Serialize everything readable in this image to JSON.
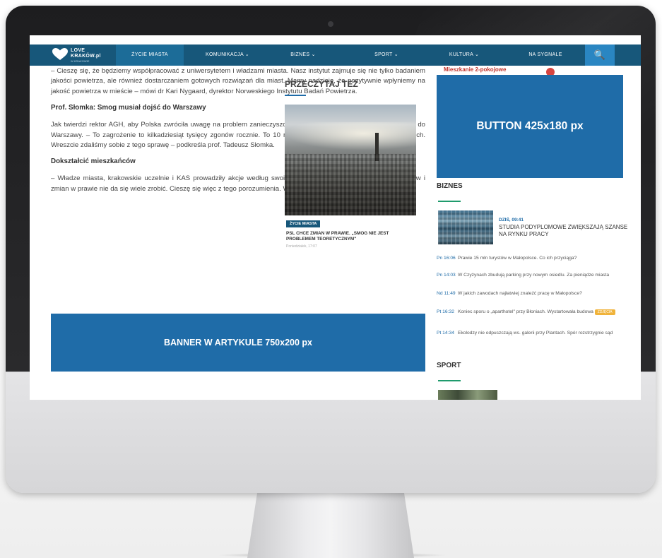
{
  "nav": {
    "logo": {
      "line1": "LOVE",
      "line2": "KRAKÓW.pl",
      "line3": "W KRAKOWIE"
    },
    "items": [
      {
        "label": "ŻYCIE MIASTA",
        "active": true
      },
      {
        "label": "KOMUNIKACJA ⌄"
      },
      {
        "label": "BIZNES ⌄"
      },
      {
        "label": "SPORT ⌄"
      },
      {
        "label": "KULTURA ⌄"
      },
      {
        "label": "NA SYGNALE"
      }
    ],
    "search_icon": "🔍"
  },
  "article": {
    "p1": "– Cieszę się, że będziemy współpracować z uniwersytetem i władzami miasta. Nasz instytut zajmuje się nie tylko badaniem jakości powietrza, ale również dostarczaniem gotowych rozwiązań dla miast. Mamy nadzieję, że pozytywnie wpłyniemy na jakość powietrza w mieście – mówi dr Kari Nygaard, dyrektor Norweskiego Instytutu Badań Powietrza.",
    "h1": "Prof. Słomka: Smog musiał dojść do Warszawy",
    "p2": "Jak twierdzi rektor AGH, aby Polska zwróciła uwagę na problem zanieczyszczonego powietrza, musiało ono dotrzeć aż do Warszawy. – To zagrożenie to kilkadziesiąt tysięcy zgonów rocznie. To 10 razy więcej niż z wypadków samochodowych. Wreszcie zdaliśmy sobie z tego sprawę – podkreśla prof. Tadeusz Słomka.",
    "h2": "Dokształcić mieszkańców",
    "p3": "– Władze miasta, krakowskie uczelnie i KAS prowadziły akcje według swoich możliwości. Jednak bez dużych środków i zmian w prawie nie da się wiele zrobić. Cieszę się więc z tego porozumienia. W AGH"
  },
  "banner": {
    "label": "BANNER W ARTYKULE 750x200 px"
  },
  "read_more": {
    "header": "PRZECZYTAJ TEŻ",
    "tag": "ŻYCIE MIASTA",
    "title": "PSL CHCE ZMIAN W PRAWIE. „SMOG NIE JEST PROBLEMEM TEORETYCZNYM\"",
    "date": "Poniedziałek, 17:07"
  },
  "sidebar": {
    "ad_top": "Mieszkanie 2-pokojowe",
    "button_ad": "BUTTON 425x180 px",
    "biznes_header": "BIZNES",
    "featured": {
      "date": "DZIŚ, 09:41",
      "title": "STUDIA PODYPLOMOWE ZWIĘKSZAJĄ SZANSE NA RYNKU PRACY"
    },
    "news": [
      {
        "time": "Pn 16:06",
        "text": "Prawie 15 mln turystów w Małopolsce. Co ich przyciąga?"
      },
      {
        "time": "Pn 14:03",
        "text": "W Czyżynach zbudują parking przy nowym osiedlu. Za pieniądze miasta"
      },
      {
        "time": "Nd 11:49",
        "text": "W jakich zawodach najłatwiej znaleźć pracę w Małopolsce?"
      },
      {
        "time": "Pt 16:32",
        "text": "Koniec sporu o „aparthotel\" przy Błoniach. Wystartowała budowa",
        "pill": "ZDJĘCIA"
      },
      {
        "time": "Pt 14:34",
        "text": "Ekolodzy nie odpuszczają ws. galerii przy Plantach. Spór rozstrzygnie sąd"
      }
    ],
    "sport_header": "SPORT"
  }
}
